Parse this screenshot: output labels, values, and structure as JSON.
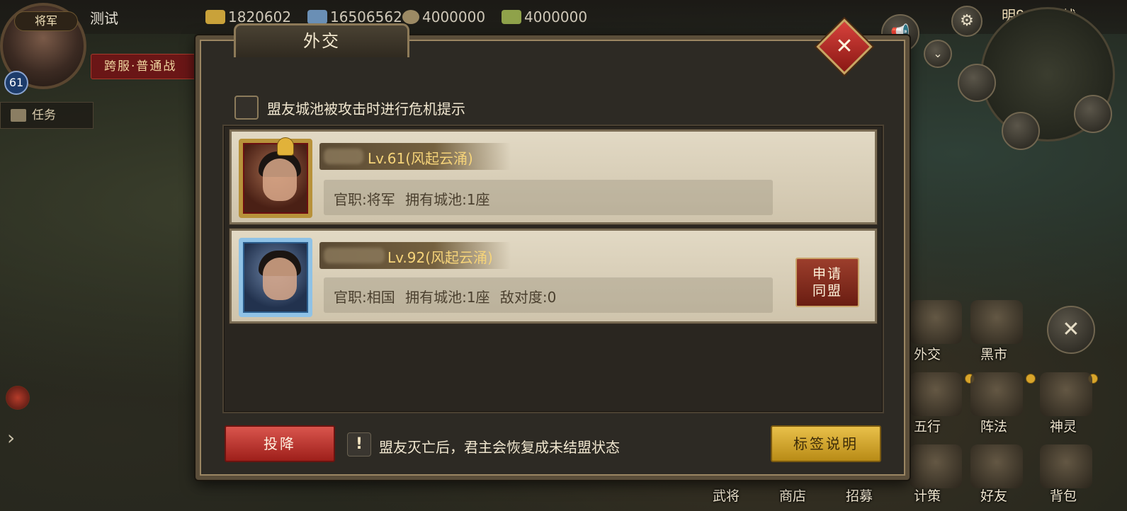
{
  "hud": {
    "rank": "将军",
    "level": "61",
    "player_name": "测试",
    "server_banner": "跨服·普通战",
    "task_label": "任务",
    "battle_time": "明9:00开战",
    "resources": [
      {
        "icon": "gold-ingot-icon",
        "value": "1820602",
        "color": "#c9a23a"
      },
      {
        "icon": "silver-icon",
        "value": "16506562",
        "color": "#6a8fb5"
      },
      {
        "icon": "coin-icon",
        "value": "4000000",
        "color": "#9c8a64"
      },
      {
        "icon": "grain-icon",
        "value": "4000000",
        "color": "#8fa24a"
      }
    ]
  },
  "menu": {
    "diplomacy": "外交",
    "black_market": "黑市",
    "five_elements": "五行",
    "formation": "阵法",
    "spirit": "神灵",
    "generals": "武将",
    "shop": "商店",
    "recruit": "招募",
    "strategy": "计策",
    "friends": "好友",
    "bag": "背包"
  },
  "dialog": {
    "title": "外交",
    "close_icon": "close-icon",
    "crisis_option": {
      "label": "盟友城池被攻击时进行危机提示",
      "checked": false
    },
    "allies": [
      {
        "name_text": "Lv.61(风起云涌)",
        "info": "官职:将军   拥有城池:1座",
        "frame_color": "#b8923a"
      },
      {
        "name_text": "Lv.92(风起云涌)",
        "info": "官职:相国   拥有城池:1座   敌对度:0",
        "frame_color": "#8fc2e6",
        "apply_line1": "申请",
        "apply_line2": "同盟"
      }
    ],
    "surrender_button": "投降",
    "hint_icon": "!",
    "hint_text": "盟友灭亡后，君主会恢复成未结盟状态",
    "tag_button": "标签说明"
  },
  "colors": {
    "accent_red": "#9e1f1a",
    "accent_gold": "#e9c04a",
    "level_gold": "#f6d47a"
  }
}
